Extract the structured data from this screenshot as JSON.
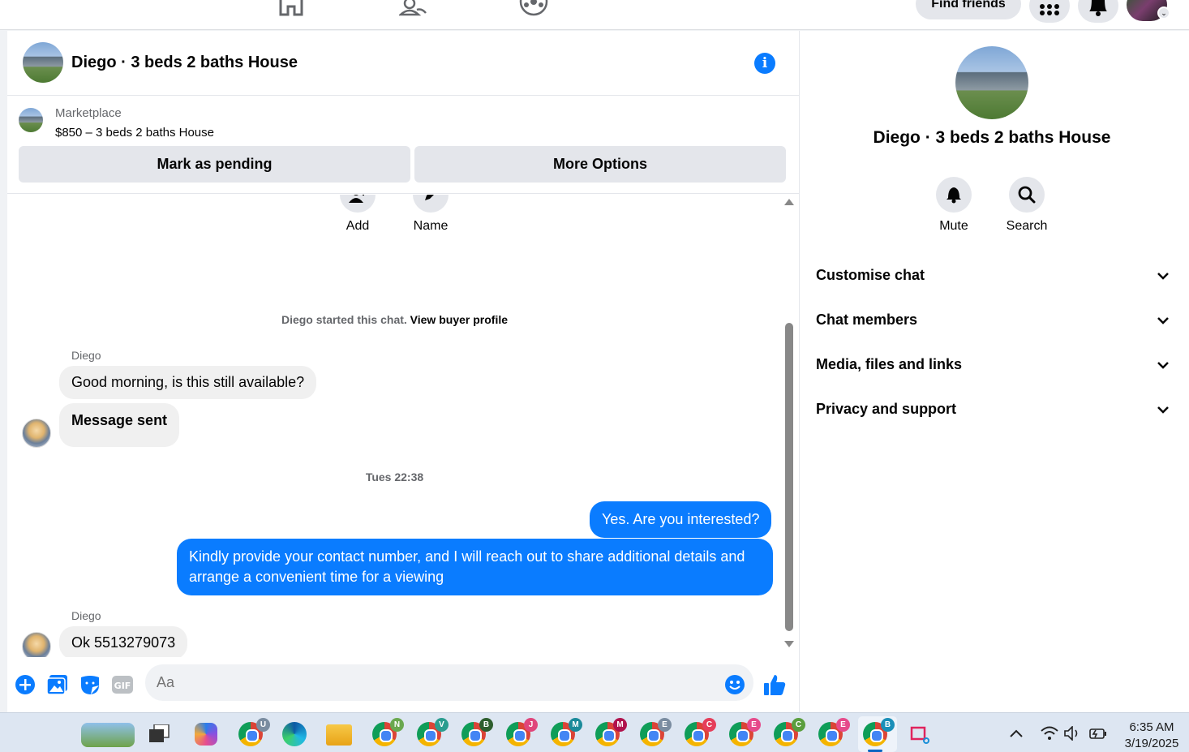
{
  "topnav": {
    "find_friends": "Find friends"
  },
  "chat": {
    "title": "Diego · 3 beds 2 baths House",
    "marketplace": {
      "label": "Marketplace",
      "listing": "$850 – 3 beds 2 baths House",
      "mark_pending": "Mark as pending",
      "more_options": "More Options"
    },
    "actions": {
      "add": "Add",
      "name": "Name"
    },
    "started": {
      "text": "Diego started this chat.",
      "link": "View buyer profile"
    },
    "messages": [
      {
        "sender": "Diego",
        "text": "Good morning, is this still available?"
      },
      {
        "text": "Message sent"
      },
      {
        "separator": "Tues 22:38"
      },
      {
        "text": "Yes. Are you interested?"
      },
      {
        "text": "Kindly provide your contact number, and I will reach out to share additional details and arrange a convenient time for a viewing"
      },
      {
        "sender": "Diego",
        "text": "Ok 5513279073"
      }
    ],
    "composer": {
      "placeholder": "Aa"
    }
  },
  "info_panel": {
    "title": "Diego · 3 beds 2 baths House",
    "mute": "Mute",
    "search": "Search",
    "sections": [
      "Customise chat",
      "Chat members",
      "Media, files and links",
      "Privacy and support"
    ]
  },
  "taskbar": {
    "badges": [
      "U",
      "N",
      "V",
      "B",
      "J",
      "M",
      "M",
      "E",
      "C",
      "E",
      "C",
      "E",
      "B"
    ],
    "time": "6:35 AM",
    "date": "3/19/2025"
  },
  "colors": {
    "accent": "#0a7cff",
    "bubble_in": "#f0f0f0",
    "button_bg": "#e4e6eb"
  }
}
